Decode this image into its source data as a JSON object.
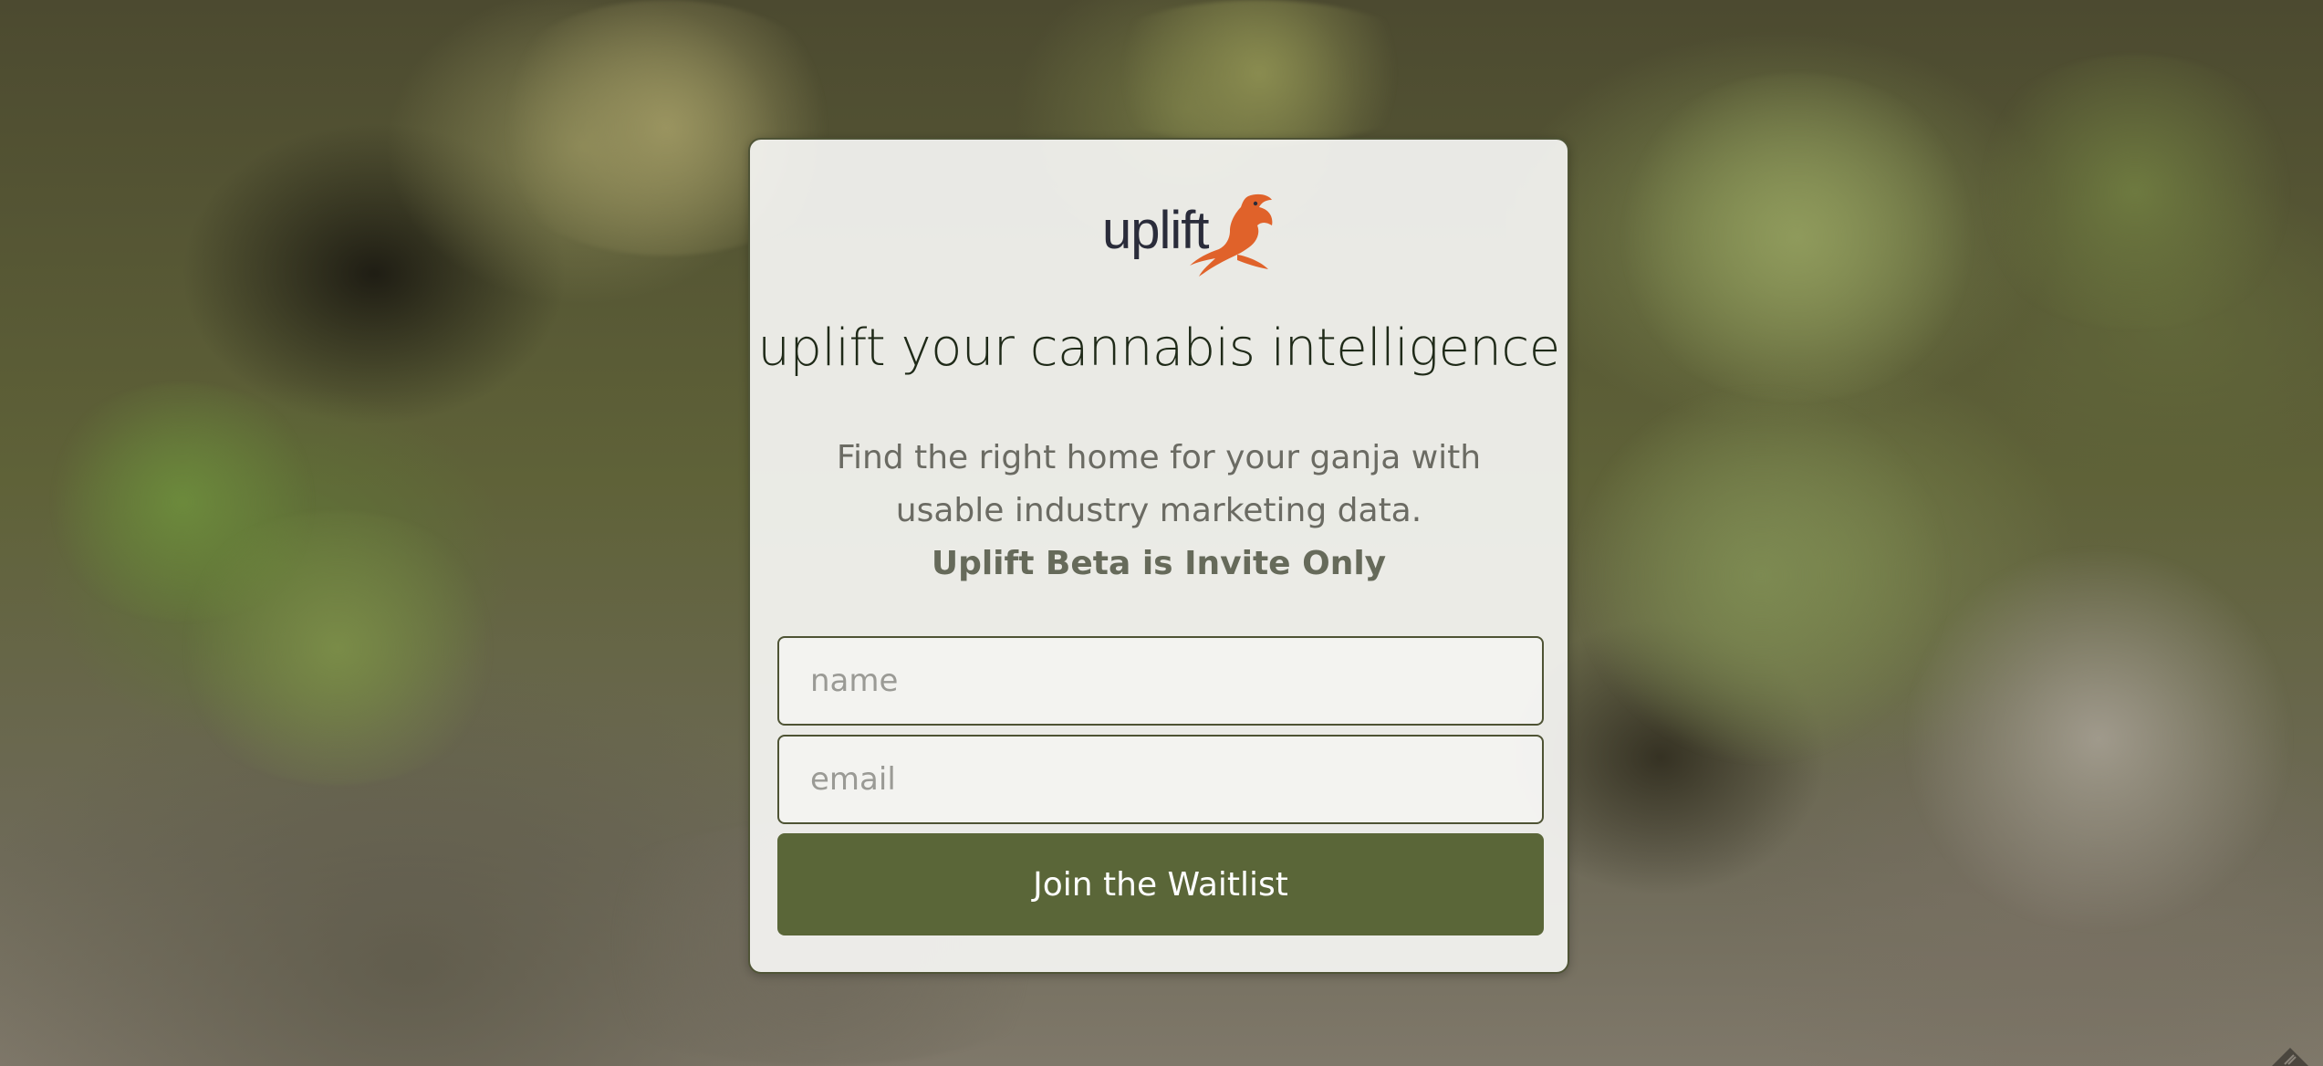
{
  "brand": {
    "logo_text": "uplift",
    "logo_accent_color": "#e0622a"
  },
  "hero": {
    "headline": "uplift your cannabis intelligence",
    "description_line1": "Find the right home for your ganja with",
    "description_line2": "usable industry marketing data.",
    "invite_note": "Uplift Beta is Invite Only"
  },
  "form": {
    "name_placeholder": "name",
    "email_placeholder": "email",
    "name_value": "",
    "email_value": "",
    "submit_label": "Join the Waitlist"
  },
  "colors": {
    "primary_button": "#5a6638",
    "field_border": "#4e5334"
  },
  "icons": {
    "corner": "diamond-badge-icon",
    "logo_mark": "bird-icon"
  }
}
